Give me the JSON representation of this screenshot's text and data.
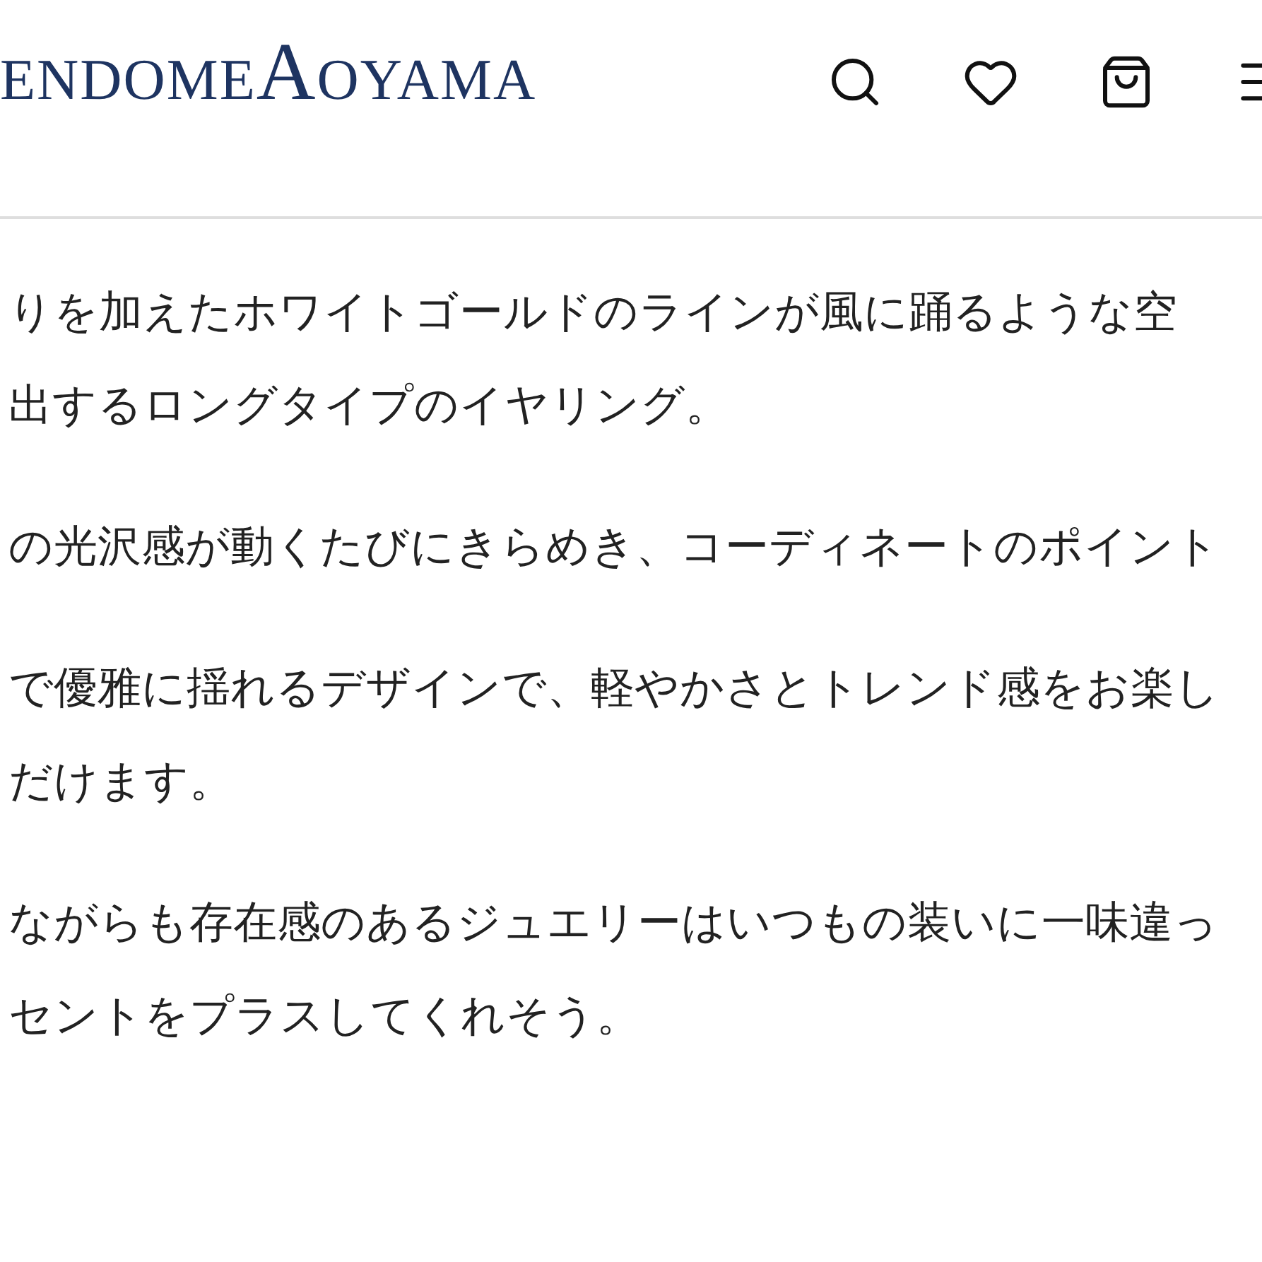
{
  "header": {
    "logo": "endomeAoyama",
    "icons": [
      {
        "kind": "search"
      },
      {
        "kind": "favorites"
      },
      {
        "kind": "cart"
      },
      {
        "kind": "menu"
      }
    ]
  },
  "paragraphs": [
    {
      "lines": [
        "りを加えたホワイトゴールドのラインが風に踊るような空",
        "出するロングタイプのイヤリング。"
      ]
    },
    {
      "lines": [
        "の光沢感が動くたびにきらめき、コーディネートのポイント"
      ]
    },
    {
      "lines": [
        "で優雅に揺れるデザインで、軽やかさとトレンド感をお楽し",
        "だけます。"
      ]
    },
    {
      "lines": [
        "ながらも存在感のあるジュエリーはいつもの装いに一味違っ",
        "セントをプラスしてくれそう。"
      ]
    }
  ]
}
